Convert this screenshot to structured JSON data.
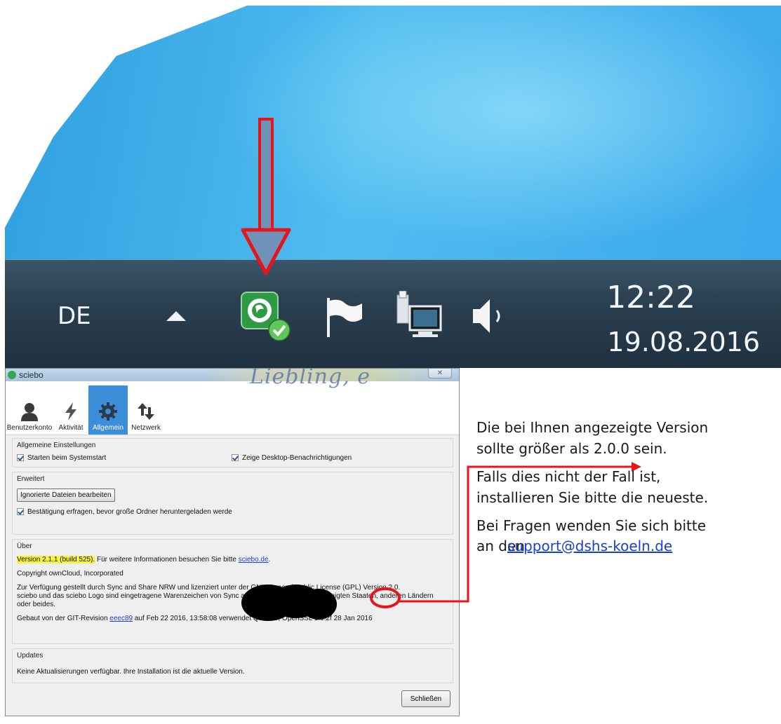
{
  "taskbar": {
    "language": "DE",
    "time": "12:22",
    "date": "19.08.2016",
    "icons": [
      "show-hidden-icons-icon",
      "sciebo-icon",
      "action-center-flag-icon",
      "network-icon",
      "speaker-icon"
    ]
  },
  "dialog": {
    "title": "sciebo",
    "title_bg_text": "Liebling, e",
    "close_symbol": "✕",
    "tabs": [
      {
        "label": "Benutzerkonto",
        "icon": "user-icon"
      },
      {
        "label": "Aktivität",
        "icon": "lightning-icon"
      },
      {
        "label": "Allgemein",
        "icon": "gear-icon"
      },
      {
        "label": "Netzwerk",
        "icon": "network-arrows-icon"
      }
    ],
    "general": {
      "heading": "Allgemeine Einstellungen",
      "startup": "Starten beim Systemstart",
      "notifications": "Zeige Desktop-Benachrichtigungen"
    },
    "advanced": {
      "heading": "Erweitert",
      "ignored_button": "Ignorierte Dateien bearbeiten",
      "confirm_large": "Bestätigung erfragen, bevor große Ordner heruntergeladen werde"
    },
    "about": {
      "heading": "Über",
      "version_highlight": "Version 2.1.1 (build 525).",
      "version_rest": " Für weitere Informationen besuchen Sie bitte ",
      "site_link": "sciebo.de",
      "site_suffix": ".",
      "copyright": "Copyright ownCloud, Incorporated",
      "license_line1": "Zur Verfügung gestellt durch Sync and Share NRW und lizenziert unter der GNU General Public License (GPL) Version 2.0.",
      "license_line2": "sciebo und das sciebo Logo sind eingetragene Warenzeichen von Sync and Share NRW in den Vereinigten Staaten, anderen Ländern",
      "license_line3": "oder beides.",
      "build_prefix": "Gebaut von der GIT-Revision ",
      "build_rev": "eeec89",
      "build_suffix": " auf Feb 22 2016, 13:58:08 verwendet Qt 5.4.0, OpenSSL 1.0.2f 28 Jan 2016"
    },
    "updates": {
      "heading": "Updates",
      "status": "Keine Aktualisierungen verfügbar. Ihre Installation ist die aktuelle Version."
    },
    "close_button": "Schließen"
  },
  "notes": {
    "line1": "Die bei Ihnen angezeigte Version",
    "line2": "sollte größer als 2.0.0 sein.",
    "line3": "Falls dies nicht der Fall ist,",
    "line4": "installieren Sie bitte die neueste.",
    "line5": "Bei Fragen wenden Sie sich bitte",
    "line6_lead": "an den ",
    "support_email": "support@dshs-koeln.de"
  },
  "colors": {
    "annotation_red": "#e8141c",
    "highlight_yellow": "#f8f43a",
    "active_tab_blue": "#3c8ed8",
    "link_blue": "#1a3fd0"
  }
}
